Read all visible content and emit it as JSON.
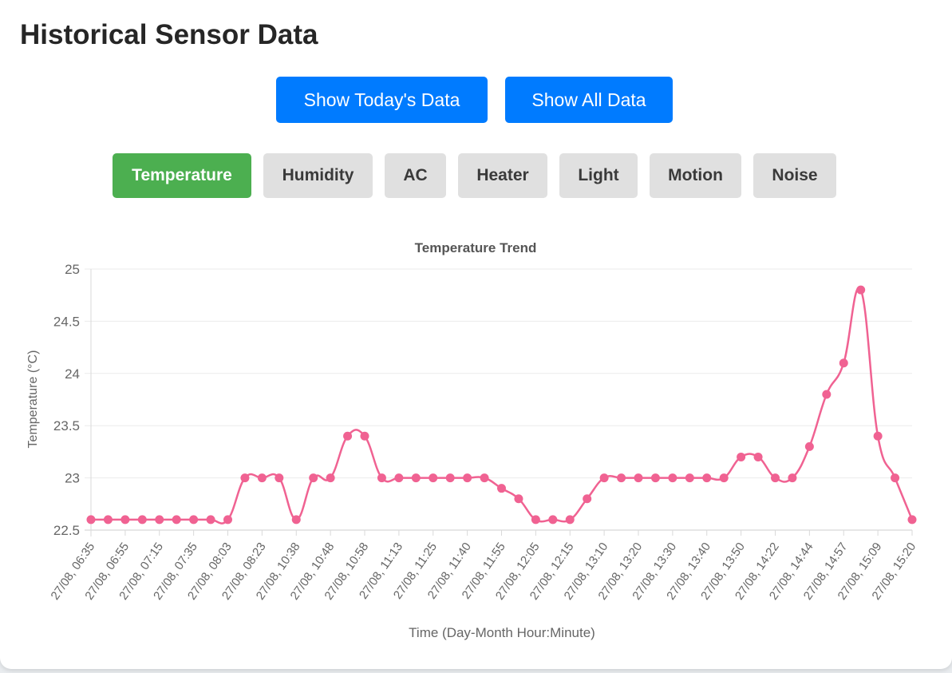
{
  "page": {
    "title": "Historical Sensor Data"
  },
  "range_buttons": {
    "today": "Show Today's Data",
    "all": "Show All Data"
  },
  "sensor_tabs": [
    {
      "label": "Temperature",
      "active": true
    },
    {
      "label": "Humidity",
      "active": false
    },
    {
      "label": "AC",
      "active": false
    },
    {
      "label": "Heater",
      "active": false
    },
    {
      "label": "Light",
      "active": false
    },
    {
      "label": "Motion",
      "active": false
    },
    {
      "label": "Noise",
      "active": false
    }
  ],
  "colors": {
    "primary_button": "#007bff",
    "active_tab": "#4caf50",
    "inactive_tab": "#e0e0e0",
    "series_line": "#f06292"
  },
  "chart_data": {
    "type": "line",
    "title": "Temperature Trend",
    "xlabel": "Time (Day-Month Hour:Minute)",
    "ylabel": "Temperature (°C)",
    "ylim": [
      22.5,
      25
    ],
    "yticks": [
      "25",
      "24.5",
      "24",
      "23.5",
      "23",
      "22.5"
    ],
    "x_tick_labels": [
      "27/08, 06:35",
      "27/08, 06:55",
      "27/08, 07:15",
      "27/08, 07:35",
      "27/08, 08:03",
      "27/08, 08:23",
      "27/08, 10:38",
      "27/08, 10:48",
      "27/08, 10:58",
      "27/08, 11:13",
      "27/08, 11:25",
      "27/08, 11:40",
      "27/08, 11:55",
      "27/08, 12:05",
      "27/08, 12:15",
      "27/08, 13:10",
      "27/08, 13:20",
      "27/08, 13:30",
      "27/08, 13:40",
      "27/08, 13:50",
      "27/08, 14:22",
      "27/08, 14:44",
      "27/08, 14:57",
      "27/08, 15:09",
      "27/08, 15:20"
    ],
    "grid": true,
    "series": [
      {
        "values": [
          22.6,
          22.6,
          22.6,
          22.6,
          22.6,
          22.6,
          22.6,
          22.6,
          22.6,
          23.0,
          23.0,
          23.0,
          22.6,
          23.0,
          23.0,
          23.4,
          23.4,
          23.0,
          23.0,
          23.0,
          23.0,
          23.0,
          23.0,
          23.0,
          22.9,
          22.8,
          22.6,
          22.6,
          22.6,
          22.8,
          23.0,
          23.0,
          23.0,
          23.0,
          23.0,
          23.0,
          23.0,
          23.0,
          23.2,
          23.2,
          23.0,
          23.0,
          23.3,
          23.8,
          24.1,
          24.8,
          23.4,
          23.0,
          22.6
        ]
      }
    ]
  }
}
